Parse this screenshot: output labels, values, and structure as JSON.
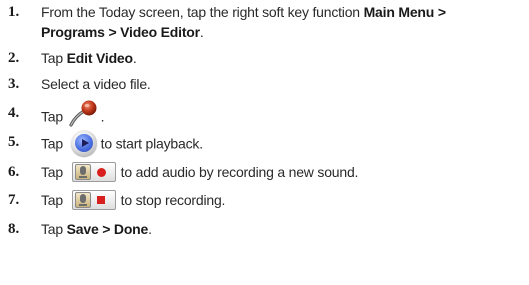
{
  "steps": [
    {
      "num": "1.",
      "line1_a": "From the Today screen, tap the right soft key function ",
      "line1_b": "Main Menu >",
      "line2_a": "Programs > Video Editor",
      "line2_b": "."
    },
    {
      "num": "2.",
      "pre": "Tap ",
      "bold": "Edit Video",
      "post": "."
    },
    {
      "num": "3.",
      "text": "Select a video file."
    },
    {
      "num": "4.",
      "pre": "Tap ",
      "icon": "microphone-icon",
      "post": "."
    },
    {
      "num": "5.",
      "pre": "Tap ",
      "icon": "play-button-icon",
      "post": "to start playback."
    },
    {
      "num": "6.",
      "pre": "Tap ",
      "icon": "record-audio-button-icon",
      "post": "to add audio by recording a new sound."
    },
    {
      "num": "7.",
      "pre": "Tap ",
      "icon": "stop-recording-button-icon",
      "post": "to stop recording."
    },
    {
      "num": "8.",
      "pre": "Tap ",
      "bold": "Save > Done",
      "post": "."
    }
  ],
  "colors": {
    "text": "#2a2a2a",
    "record_red": "#d91e1e",
    "play_blue": "#4a6fe0"
  }
}
